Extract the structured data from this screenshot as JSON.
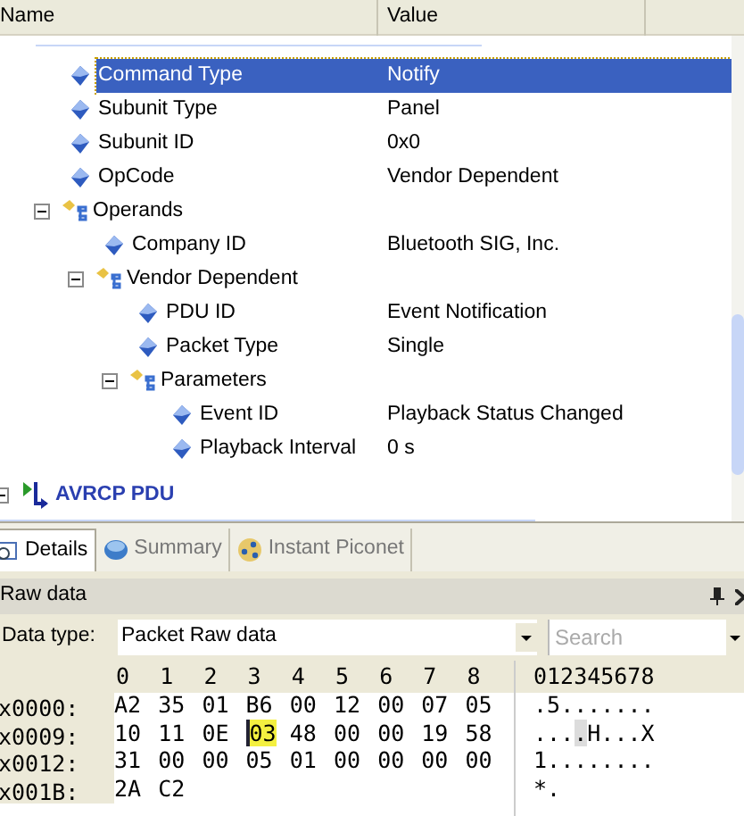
{
  "tree_header": {
    "columns": [
      "Name",
      "Value"
    ]
  },
  "fields": [
    {
      "name": "Command Type",
      "value": "Notify",
      "kind": "field",
      "selected": true
    },
    {
      "name": "Subunit Type",
      "value": "Panel",
      "kind": "field",
      "selected": false
    },
    {
      "name": "Subunit ID",
      "value": "0x0",
      "kind": "field",
      "selected": false
    },
    {
      "name": "OpCode",
      "value": "Vendor Dependent",
      "kind": "field",
      "selected": false
    },
    {
      "name": "Operands",
      "kind": "group",
      "expanded": true,
      "selected": false,
      "children": [
        {
          "name": "Company ID",
          "value": "Bluetooth SIG, Inc.",
          "kind": "field",
          "selected": false
        },
        {
          "name": "Vendor Dependent",
          "kind": "group",
          "expanded": true,
          "selected": false,
          "children": [
            {
              "name": "PDU ID",
              "value": "Event Notification",
              "kind": "field",
              "selected": false
            },
            {
              "name": "Packet Type",
              "value": "Single",
              "kind": "field",
              "selected": false
            },
            {
              "name": "Parameters",
              "kind": "group",
              "expanded": true,
              "selected": false,
              "children": [
                {
                  "name": "Event ID",
                  "value": "Playback Status Changed",
                  "kind": "field",
                  "selected": false
                },
                {
                  "name": "Playback Interval",
                  "value": "0 s",
                  "kind": "field",
                  "selected": false
                }
              ]
            }
          ]
        }
      ]
    }
  ],
  "next_packet": {
    "name": "AVRCP PDU",
    "expanded": true
  },
  "tabs": [
    {
      "label": "Details",
      "selected": true
    },
    {
      "label": "Summary",
      "selected": false
    },
    {
      "label": "Instant Piconet",
      "selected": false
    }
  ],
  "raw_panel": {
    "title": "Raw data",
    "data_type_label": "Data type:",
    "data_type": "Packet Raw data",
    "search": {
      "placeholder": "Search"
    }
  },
  "hex": {
    "columns": [
      "0",
      "1",
      "2",
      "3",
      "4",
      "5",
      "6",
      "7",
      "8"
    ],
    "ascii_header": "012345678",
    "rows": [
      {
        "address": "x0000:",
        "ascii": ".5.......",
        "bytes": [
          {
            "text": "A2",
            "selected": false
          },
          {
            "text": "35",
            "selected": false
          },
          {
            "text": "01",
            "selected": false
          },
          {
            "text": "B6",
            "selected": false
          },
          {
            "text": "00",
            "selected": false
          },
          {
            "text": "12",
            "selected": false
          },
          {
            "text": "00",
            "selected": false
          },
          {
            "text": "07",
            "selected": false
          },
          {
            "text": "05",
            "selected": false
          }
        ]
      },
      {
        "address": "x0009:",
        "ascii": "....H...X",
        "bytes": [
          {
            "text": "10",
            "selected": false
          },
          {
            "text": "11",
            "selected": false
          },
          {
            "text": "0E",
            "selected": false
          },
          {
            "text": "03",
            "selected": true
          },
          {
            "text": "48",
            "selected": false
          },
          {
            "text": "00",
            "selected": false
          },
          {
            "text": "00",
            "selected": false
          },
          {
            "text": "19",
            "selected": false
          },
          {
            "text": "58",
            "selected": false
          }
        ]
      },
      {
        "address": "x0012:",
        "ascii": "1........",
        "bytes": [
          {
            "text": "31",
            "selected": false
          },
          {
            "text": "00",
            "selected": false
          },
          {
            "text": "00",
            "selected": false
          },
          {
            "text": "05",
            "selected": false
          },
          {
            "text": "01",
            "selected": false
          },
          {
            "text": "00",
            "selected": false
          },
          {
            "text": "00",
            "selected": false
          },
          {
            "text": "00",
            "selected": false
          },
          {
            "text": "00",
            "selected": false
          }
        ]
      },
      {
        "address": "x001B:",
        "ascii": "*.",
        "bytes": [
          {
            "text": "2A",
            "selected": false
          },
          {
            "text": "C2",
            "selected": false
          }
        ]
      }
    ]
  }
}
